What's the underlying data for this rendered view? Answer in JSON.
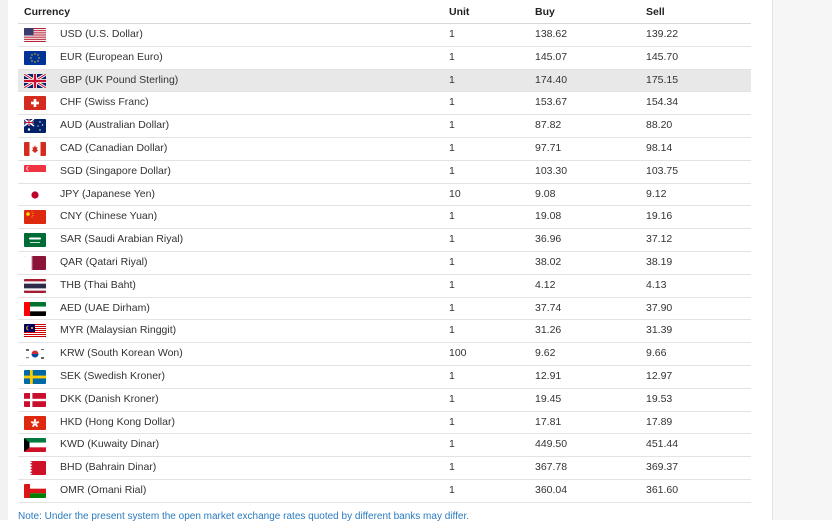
{
  "table": {
    "headers": {
      "currency": "Currency",
      "unit": "Unit",
      "buy": "Buy",
      "sell": "Sell"
    },
    "rows": [
      {
        "code_name": "USD (U.S. Dollar)",
        "unit": "1",
        "buy": "138.62",
        "sell": "139.22",
        "flag": "usa-flag-icon"
      },
      {
        "code_name": "EUR (European Euro)",
        "unit": "1",
        "buy": "145.07",
        "sell": "145.70",
        "flag": "eu-flag-icon"
      },
      {
        "code_name": "GBP (UK Pound Sterling)",
        "unit": "1",
        "buy": "174.40",
        "sell": "175.15",
        "flag": "uk-flag-icon"
      },
      {
        "code_name": "CHF (Swiss Franc)",
        "unit": "1",
        "buy": "153.67",
        "sell": "154.34",
        "flag": "swiss-flag-icon"
      },
      {
        "code_name": "AUD (Australian Dollar)",
        "unit": "1",
        "buy": "87.82",
        "sell": "88.20",
        "flag": "australia-flag-icon"
      },
      {
        "code_name": "CAD (Canadian Dollar)",
        "unit": "1",
        "buy": "97.71",
        "sell": "98.14",
        "flag": "canada-flag-icon"
      },
      {
        "code_name": "SGD (Singapore Dollar)",
        "unit": "1",
        "buy": "103.30",
        "sell": "103.75",
        "flag": "singapore-flag-icon"
      },
      {
        "code_name": "JPY (Japanese Yen)",
        "unit": "10",
        "buy": "9.08",
        "sell": "9.12",
        "flag": "japan-flag-icon"
      },
      {
        "code_name": "CNY (Chinese Yuan)",
        "unit": "1",
        "buy": "19.08",
        "sell": "19.16",
        "flag": "china-flag-icon"
      },
      {
        "code_name": "SAR (Saudi Arabian Riyal)",
        "unit": "1",
        "buy": "36.96",
        "sell": "37.12",
        "flag": "saudi-flag-icon"
      },
      {
        "code_name": "QAR (Qatari Riyal)",
        "unit": "1",
        "buy": "38.02",
        "sell": "38.19",
        "flag": "qatar-flag-icon"
      },
      {
        "code_name": "THB (Thai Baht)",
        "unit": "1",
        "buy": "4.12",
        "sell": "4.13",
        "flag": "thailand-flag-icon"
      },
      {
        "code_name": "AED (UAE Dirham)",
        "unit": "1",
        "buy": "37.74",
        "sell": "37.90",
        "flag": "uae-flag-icon"
      },
      {
        "code_name": "MYR (Malaysian Ringgit)",
        "unit": "1",
        "buy": "31.26",
        "sell": "31.39",
        "flag": "malaysia-flag-icon"
      },
      {
        "code_name": "KRW (South Korean Won)",
        "unit": "100",
        "buy": "9.62",
        "sell": "9.66",
        "flag": "korea-flag-icon"
      },
      {
        "code_name": "SEK (Swedish Kroner)",
        "unit": "1",
        "buy": "12.91",
        "sell": "12.97",
        "flag": "sweden-flag-icon"
      },
      {
        "code_name": "DKK (Danish Kroner)",
        "unit": "1",
        "buy": "19.45",
        "sell": "19.53",
        "flag": "denmark-flag-icon"
      },
      {
        "code_name": "HKD (Hong Kong Dollar)",
        "unit": "1",
        "buy": "17.81",
        "sell": "17.89",
        "flag": "hongkong-flag-icon"
      },
      {
        "code_name": "KWD (Kuwaity Dinar)",
        "unit": "1",
        "buy": "449.50",
        "sell": "451.44",
        "flag": "kuwait-flag-icon"
      },
      {
        "code_name": "BHD (Bahrain Dinar)",
        "unit": "1",
        "buy": "367.78",
        "sell": "369.37",
        "flag": "bahrain-flag-icon"
      },
      {
        "code_name": "OMR (Omani Rial)",
        "unit": "1",
        "buy": "360.04",
        "sell": "361.60",
        "flag": "oman-flag-icon"
      }
    ]
  },
  "note": "Note: Under the present system the open market exchange rates quoted by different banks may differ.",
  "colors": {
    "highlight_row": "#e8e8e8",
    "note_link": "#2a7bbf"
  }
}
